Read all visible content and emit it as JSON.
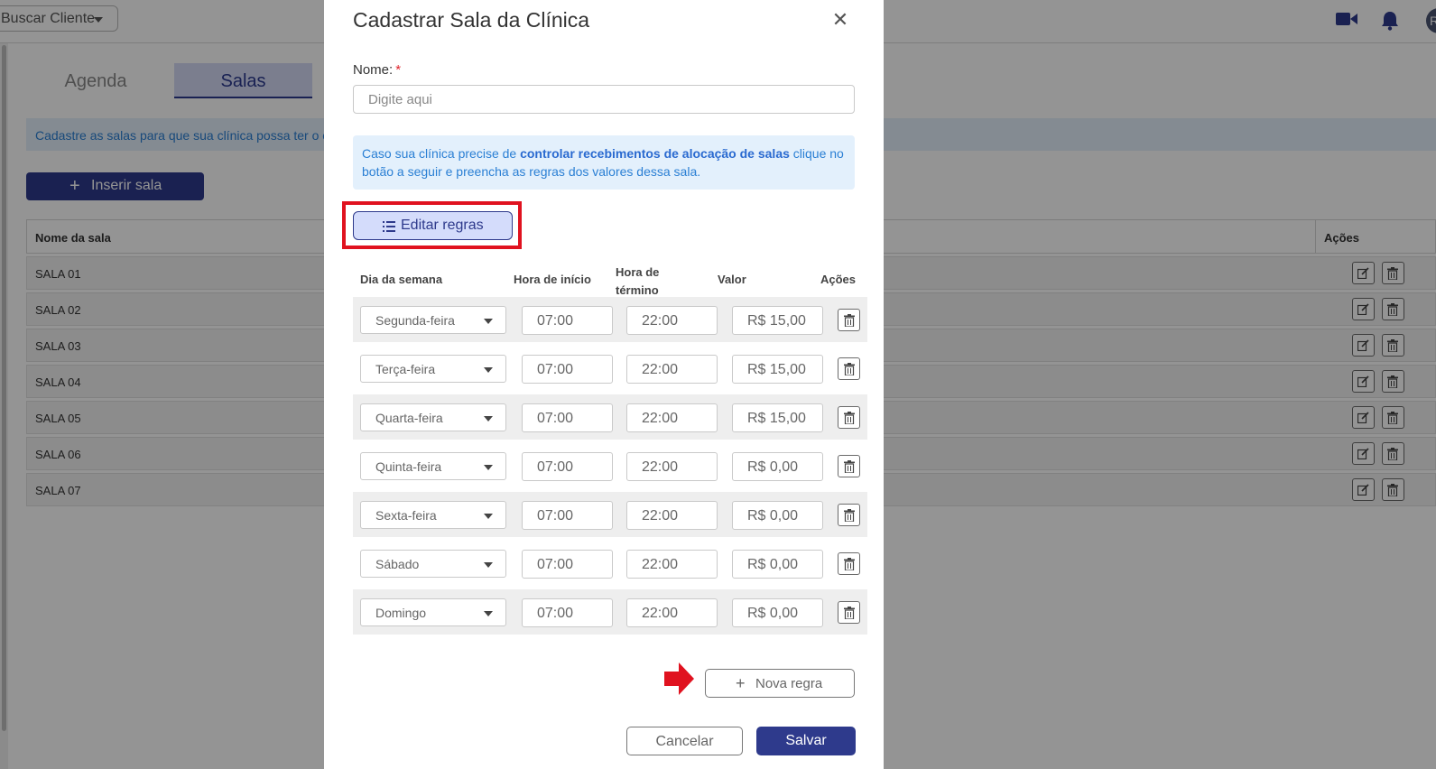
{
  "topbar": {
    "client_select": "Buscar Cliente",
    "avatar_letter": "R"
  },
  "tabs": [
    {
      "label": "Agenda"
    },
    {
      "label": "Salas"
    }
  ],
  "page": {
    "info_text": "Cadastre as salas para que sua clínica possa ter o c",
    "insert_button": "Inserir sala"
  },
  "rooms_table": {
    "col_name": "Nome da sala",
    "col_actions": "Ações",
    "rows": [
      "SALA 01",
      "SALA 02",
      "SALA 03",
      "SALA 04",
      "SALA 05",
      "SALA 06",
      "SALA 07"
    ]
  },
  "modal": {
    "title": "Cadastrar Sala da Clínica",
    "name_label": "Nome:",
    "required_mark": "*",
    "name_placeholder": "Digite aqui",
    "info_before": "Caso sua clínica precise de ",
    "info_bold": "controlar recebimentos de alocação de salas",
    "info_after": " clique no botão a seguir e preencha as regras dos valores dessa sala.",
    "edit_rules_button": "Editar regras",
    "headers": {
      "day": "Dia da semana",
      "start": "Hora de início",
      "end": "Hora de término",
      "value": "Valor",
      "actions": "Ações"
    },
    "rules": [
      {
        "day": "Segunda-feira",
        "start": "07:00",
        "end": "22:00",
        "value": "R$ 15,00"
      },
      {
        "day": "Terça-feira",
        "start": "07:00",
        "end": "22:00",
        "value": "R$ 15,00"
      },
      {
        "day": "Quarta-feira",
        "start": "07:00",
        "end": "22:00",
        "value": "R$ 15,00"
      },
      {
        "day": "Quinta-feira",
        "start": "07:00",
        "end": "22:00",
        "value": "R$ 0,00"
      },
      {
        "day": "Sexta-feira",
        "start": "07:00",
        "end": "22:00",
        "value": "R$ 0,00"
      },
      {
        "day": "Sábado",
        "start": "07:00",
        "end": "22:00",
        "value": "R$ 0,00"
      },
      {
        "day": "Domingo",
        "start": "07:00",
        "end": "22:00",
        "value": "R$ 0,00"
      }
    ],
    "new_rule_button": "Nova regra",
    "cancel_button": "Cancelar",
    "save_button": "Salvar"
  },
  "colors": {
    "primary": "#2e3a8c",
    "info_text": "#2a7fd4",
    "info_bg": "#e3f0fc",
    "highlight": "#e0121f"
  }
}
